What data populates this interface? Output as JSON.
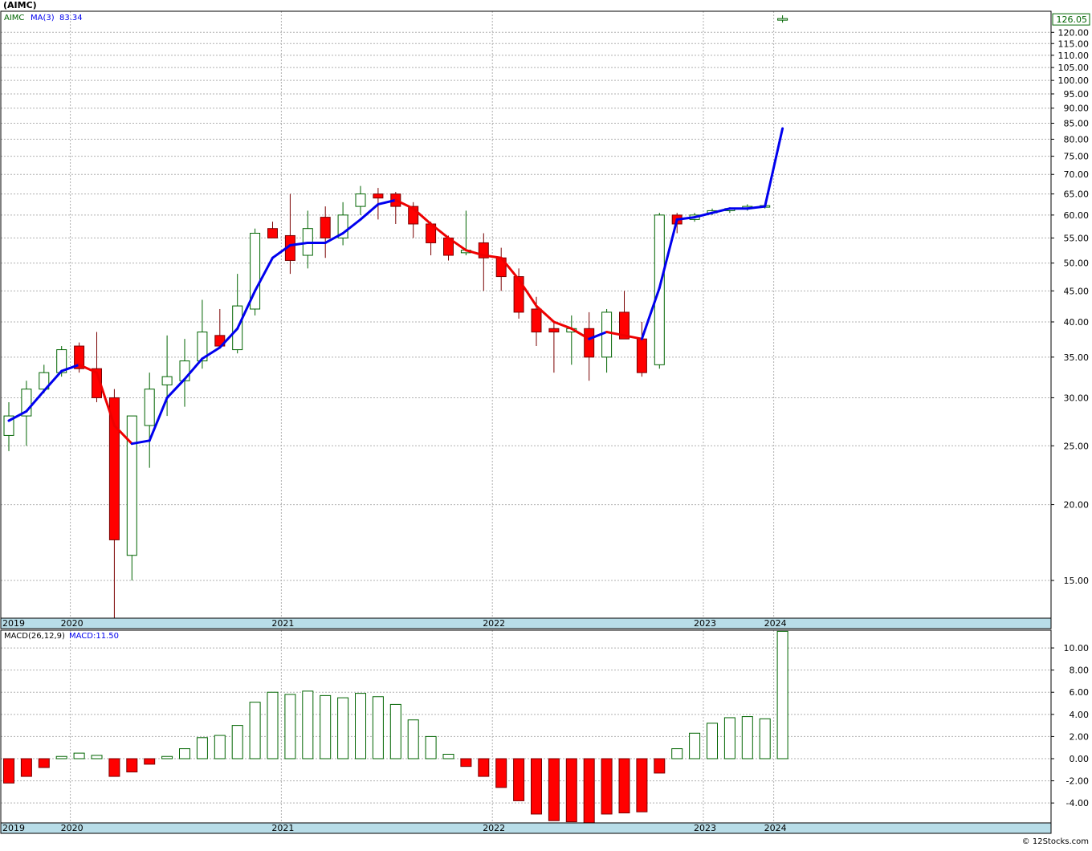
{
  "header": {
    "title": "(AIMC)"
  },
  "footer": {
    "credit": "© 12Stocks.com"
  },
  "colors": {
    "up": "#ffffff",
    "up_edge": "#006400",
    "down": "#ff0000",
    "down_edge": "#7a0000",
    "ma_up": "#0000ee",
    "ma_down": "#ee0000",
    "macd_pos_edge": "#006400",
    "macd_neg": "#ff0000",
    "grid": "#b0b0b0",
    "axis_band": "#b8dde8"
  },
  "chart_data": [
    {
      "type": "candlestick",
      "legend": {
        "symbol": "AIMC",
        "ma_label": "MA(3)",
        "ma_value": "83.34"
      },
      "y_scale": "log",
      "ylim": [
        13,
        130
      ],
      "y_ticks": [
        15,
        20,
        25,
        30,
        35,
        40,
        45,
        50,
        55,
        60,
        65,
        70,
        75,
        80,
        85,
        90,
        95,
        100,
        105,
        110,
        115,
        120
      ],
      "y_tick_labels": [
        "15.00",
        "20.00",
        "25.00",
        "30.00",
        "35.00",
        "40.00",
        "45.00",
        "50.00",
        "55.00",
        "60.00",
        "65.00",
        "70.00",
        "75.00",
        "80.00",
        "85.00",
        "90.00",
        "95.00",
        "100.00",
        "105.00",
        "110.00",
        "115.00",
        "120.00"
      ],
      "last_price": "126.05",
      "x_labels": [
        "2019",
        "2020",
        "2021",
        "2022",
        "2023",
        "2024"
      ],
      "x_label_index": [
        0,
        4,
        16,
        28,
        40,
        44
      ],
      "ohlc": [
        [
          26.0,
          29.5,
          24.5,
          28.0
        ],
        [
          28.0,
          32.0,
          25.0,
          31.0
        ],
        [
          31.0,
          34.0,
          30.5,
          33.0
        ],
        [
          33.0,
          36.5,
          32.5,
          36.0
        ],
        [
          36.5,
          37.0,
          33.0,
          33.5
        ],
        [
          33.5,
          38.5,
          29.5,
          30.0
        ],
        [
          30.0,
          31.0,
          13.0,
          17.5
        ],
        [
          16.5,
          28.0,
          15.0,
          28.0
        ],
        [
          27.0,
          33.0,
          23.0,
          31.0
        ],
        [
          31.5,
          38.0,
          28.0,
          32.5
        ],
        [
          32.0,
          37.5,
          29.0,
          34.5
        ],
        [
          34.5,
          43.5,
          33.5,
          38.5
        ],
        [
          38.0,
          42.0,
          36.5,
          36.5
        ],
        [
          36.0,
          48.0,
          35.5,
          42.5
        ],
        [
          42.0,
          57.0,
          41.0,
          56.0
        ],
        [
          57.0,
          58.5,
          55.0,
          55.0
        ],
        [
          55.5,
          65.0,
          48.0,
          50.5
        ],
        [
          51.5,
          61.0,
          49.0,
          57.0
        ],
        [
          59.5,
          62.0,
          51.0,
          55.0
        ],
        [
          55.0,
          63.0,
          53.5,
          60.0
        ],
        [
          62.0,
          67.0,
          60.0,
          65.0
        ],
        [
          65.0,
          66.5,
          59.0,
          64.0
        ],
        [
          65.0,
          65.5,
          58.0,
          62.0
        ],
        [
          62.0,
          63.0,
          55.0,
          58.0
        ],
        [
          58.0,
          58.5,
          51.5,
          54.0
        ],
        [
          55.0,
          55.5,
          50.5,
          51.5
        ],
        [
          52.0,
          61.0,
          51.5,
          52.5
        ],
        [
          54.0,
          56.0,
          45.0,
          51.0
        ],
        [
          51.0,
          53.0,
          45.0,
          47.5
        ],
        [
          47.5,
          49.0,
          40.5,
          41.5
        ],
        [
          42.0,
          44.0,
          36.5,
          38.5
        ],
        [
          39.0,
          40.0,
          33.0,
          38.5
        ],
        [
          38.5,
          41.0,
          34.0,
          39.0
        ],
        [
          39.0,
          41.5,
          32.0,
          35.0
        ],
        [
          35.0,
          42.0,
          33.0,
          41.5
        ],
        [
          41.5,
          45.0,
          37.5,
          37.5
        ],
        [
          37.5,
          40.0,
          32.5,
          33.0
        ],
        [
          34.0,
          60.5,
          33.5,
          60.0
        ],
        [
          60.0,
          60.5,
          56.0,
          58.0
        ],
        [
          59.0,
          60.5,
          58.5,
          60.0
        ],
        [
          60.5,
          61.5,
          60.0,
          61.0
        ],
        [
          61.0,
          61.5,
          60.5,
          61.5
        ],
        [
          61.5,
          62.5,
          61.0,
          62.0
        ],
        [
          62.0,
          62.5,
          61.5,
          62.0
        ],
        [
          126.05,
          128.0,
          124.5,
          126.05
        ]
      ],
      "ma": [
        27.5,
        28.5,
        30.8,
        33.2,
        34.0,
        33.0,
        27.0,
        25.2,
        25.5,
        30.0,
        32.2,
        34.8,
        36.3,
        39.0,
        45.0,
        51.0,
        53.5,
        54.0,
        54.0,
        56.0,
        59.0,
        62.5,
        63.5,
        61.5,
        58.0,
        55.0,
        52.5,
        51.5,
        51.0,
        47.0,
        42.5,
        40.0,
        39.0,
        37.5,
        38.5,
        38.0,
        37.5,
        45.5,
        59.0,
        59.5,
        60.5,
        61.5,
        61.5,
        62.0,
        83.34
      ]
    },
    {
      "type": "bar",
      "legend": {
        "label": "MACD(26,12,9)",
        "value_label": "MACD:11.50"
      },
      "ylim": [
        -5.8,
        11.6
      ],
      "y_ticks": [
        -4,
        -2,
        0,
        2,
        4,
        6,
        8,
        10
      ],
      "y_tick_labels": [
        "-4.00",
        "-2.00",
        "0.00",
        "2.00",
        "4.00",
        "6.00",
        "8.00",
        "10.00"
      ],
      "x_labels": [
        "2019",
        "2020",
        "2021",
        "2022",
        "2023",
        "2024"
      ],
      "x_label_index": [
        0,
        4,
        16,
        28,
        40,
        44
      ],
      "values": [
        -2.2,
        -1.6,
        -0.8,
        0.2,
        0.5,
        0.3,
        -1.6,
        -1.2,
        -0.5,
        0.2,
        0.9,
        1.9,
        2.1,
        3.0,
        5.1,
        6.0,
        5.8,
        6.1,
        5.7,
        5.5,
        5.9,
        5.6,
        4.9,
        3.5,
        2.0,
        0.4,
        -0.7,
        -1.6,
        -2.6,
        -3.8,
        -5.0,
        -5.6,
        -5.7,
        -5.9,
        -5.0,
        -4.9,
        -4.8,
        -1.3,
        0.9,
        2.3,
        3.2,
        3.7,
        3.8,
        3.6,
        11.5
      ]
    }
  ]
}
